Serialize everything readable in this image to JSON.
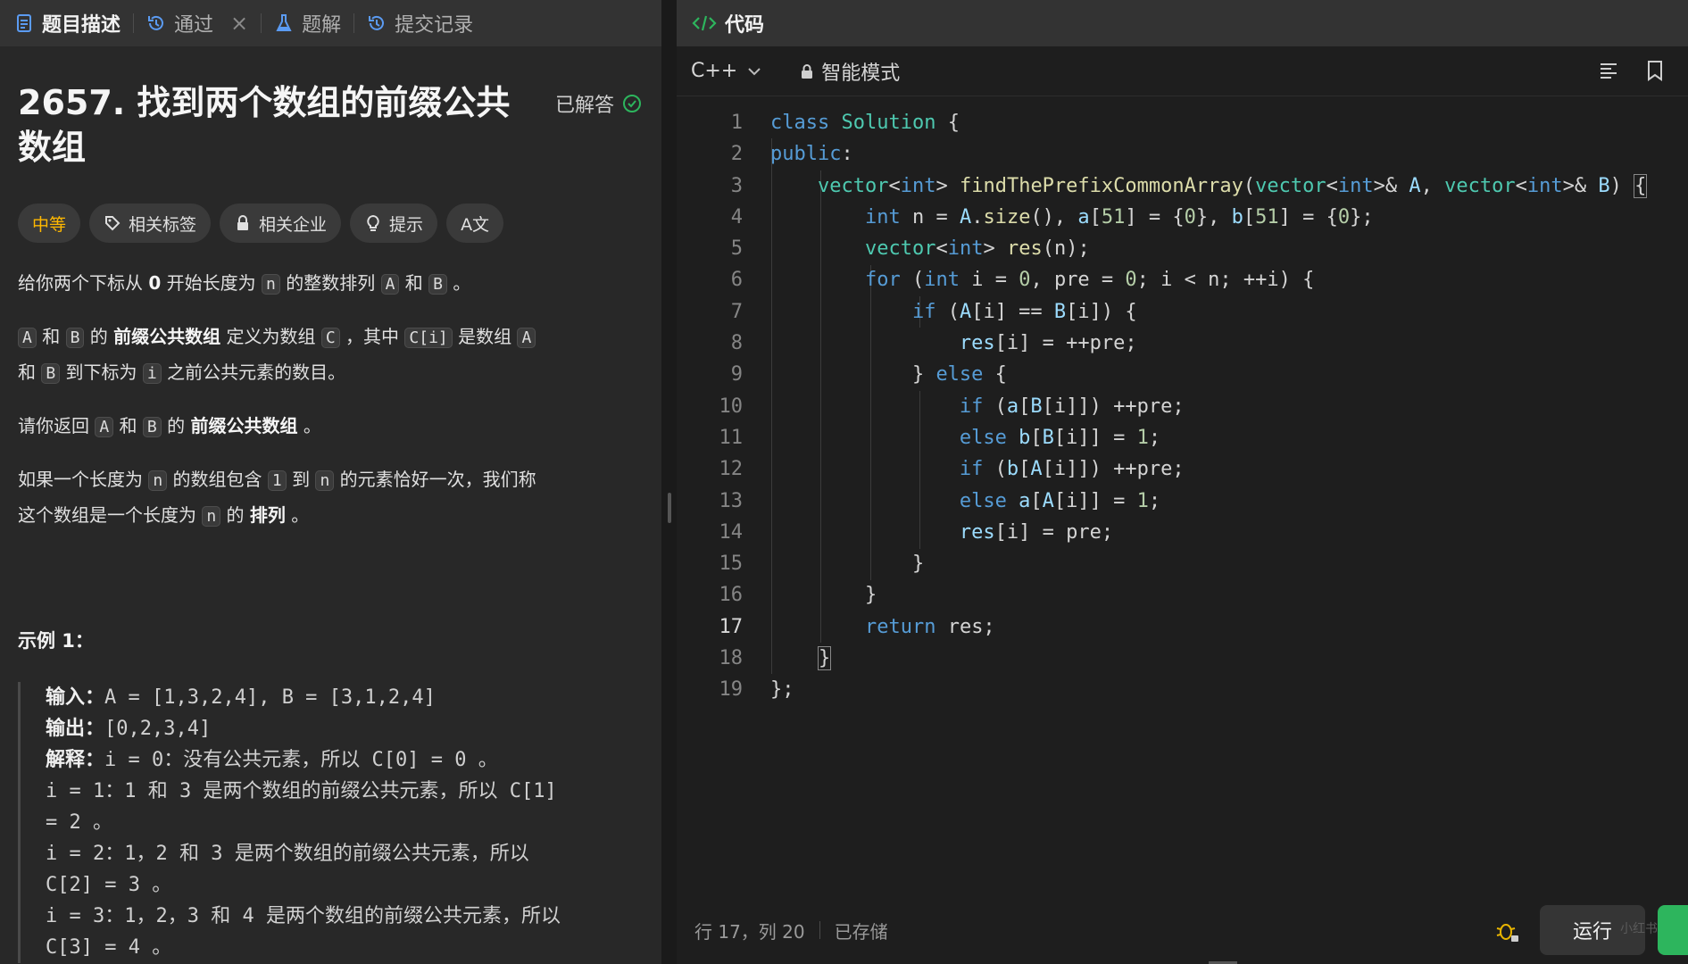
{
  "left_tabs": [
    {
      "label": "题目描述",
      "icon": "description-icon",
      "active": true
    },
    {
      "label": "通过",
      "icon": "history-icon",
      "closable": true
    },
    {
      "label": "题解",
      "icon": "flask-icon"
    },
    {
      "label": "提交记录",
      "icon": "history-icon"
    }
  ],
  "problem": {
    "title": "2657. 找到两个数组的前缀公共数组",
    "solved_label": "已解答"
  },
  "tags": {
    "difficulty": "中等",
    "related_tags": "相关标签",
    "related_companies": "相关企业",
    "hint": "提示",
    "translate": "A文"
  },
  "description": {
    "p1": {
      "t1": "给你两个下标从 ",
      "zero": "0",
      "t2": " 开始长度为 ",
      "n": "n",
      "t3": " 的整数排列 ",
      "A": "A",
      "and": " 和 ",
      "B": "B",
      "end": " 。"
    },
    "p2": {
      "A": "A",
      "and": " 和 ",
      "B": "B",
      "t1": " 的 ",
      "bold": "前缀公共数组",
      "t2": " 定义为数组 ",
      "C": "C",
      "t3": " ，其中 ",
      "Ci": "C[i]",
      "t4": " 是数组 ",
      "A2": "A",
      "t5": "和 ",
      "B2": "B",
      "t6": " 到下标为 ",
      "i": "i",
      "t7": " 之前公共元素的数目。"
    },
    "p3": {
      "t1": "请你返回 ",
      "A": "A",
      "and": " 和 ",
      "B": "B",
      "t2": " 的 ",
      "bold": "前缀公共数组",
      "end": " 。"
    },
    "p4": {
      "t1": "如果一个长度为 ",
      "n": "n",
      "t2": " 的数组包含 ",
      "one": "1",
      "t3": " 到 ",
      "n2": "n",
      "t4": " 的元素恰好一次，我们称",
      "t5": "这个数组是一个长度为 ",
      "n3": "n",
      "t6": " 的 ",
      "bold": "排列",
      "end": " 。"
    }
  },
  "example": {
    "title": "示例 1：",
    "input_label": "输入：",
    "input": "A = [1,3,2,4], B = [3,1,2,4]",
    "output_label": "输出：",
    "output": "[0,2,3,4]",
    "explain_label": "解释：",
    "lines": [
      "i = 0：没有公共元素，所以 C[0] = 0 。",
      "i = 1：1 和 3 是两个数组的前缀公共元素，所以 C[1]",
      "= 2 。",
      "i = 2：1，2 和 3 是两个数组的前缀公共元素，所以",
      "C[2] = 3 。",
      "i = 3：1，2，3 和 4 是两个数组的前缀公共元素，所以",
      "C[3] = 4 。"
    ]
  },
  "editor": {
    "tab_label": "代码",
    "language": "C++",
    "mode": "智能模式",
    "line_numbers": [
      "1",
      "2",
      "3",
      "4",
      "5",
      "6",
      "7",
      "8",
      "9",
      "10",
      "11",
      "12",
      "13",
      "14",
      "15",
      "16",
      "17",
      "18",
      "19"
    ],
    "current_line": 17
  },
  "status": {
    "cursor": "行 17，列 20",
    "saved": "已存储",
    "run_label": "运行",
    "watermark": "小红书"
  },
  "colors": {
    "difficulty": "#ffb800",
    "solved_check": "#2db55d",
    "submit": "#2db55d"
  }
}
